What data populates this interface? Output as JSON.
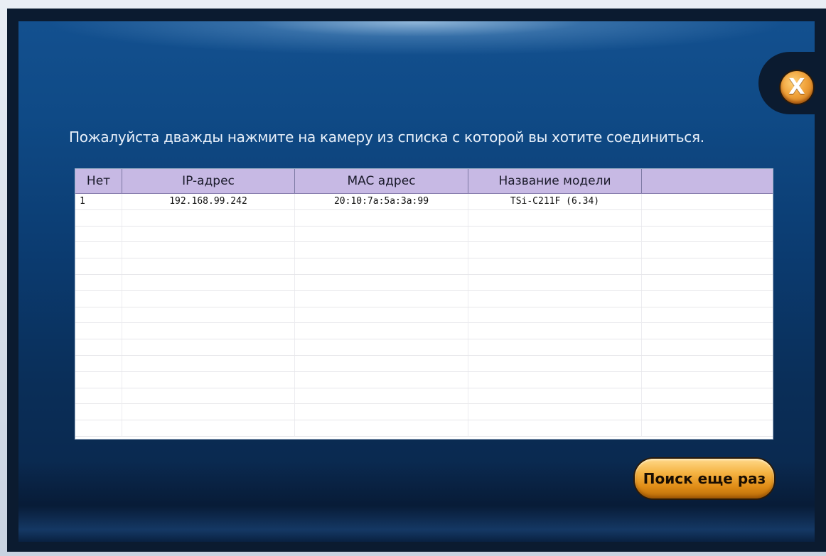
{
  "dialog": {
    "instruction": "Пожалуйста дважды нажмите на камеру из списка с которой вы хотите соединиться.",
    "close_glyph": "X",
    "search_again_label": "Поиск еще раз"
  },
  "table": {
    "columns": [
      "Нет",
      "IP-адрес",
      "MAC адрес",
      "Название модели",
      ""
    ],
    "rows": [
      [
        "1",
        "192.168.99.242",
        "20:10:7a:5a:3a:99",
        "TSi-C211F (6.34)",
        ""
      ]
    ],
    "empty_row_count": 14
  },
  "colors": {
    "panel_blue": "#0f4a86",
    "frame_dark": "#0b1b30",
    "header_lavender": "#c7b9e4",
    "button_orange": "#f5b444"
  },
  "icons": {
    "close": "close-icon"
  }
}
